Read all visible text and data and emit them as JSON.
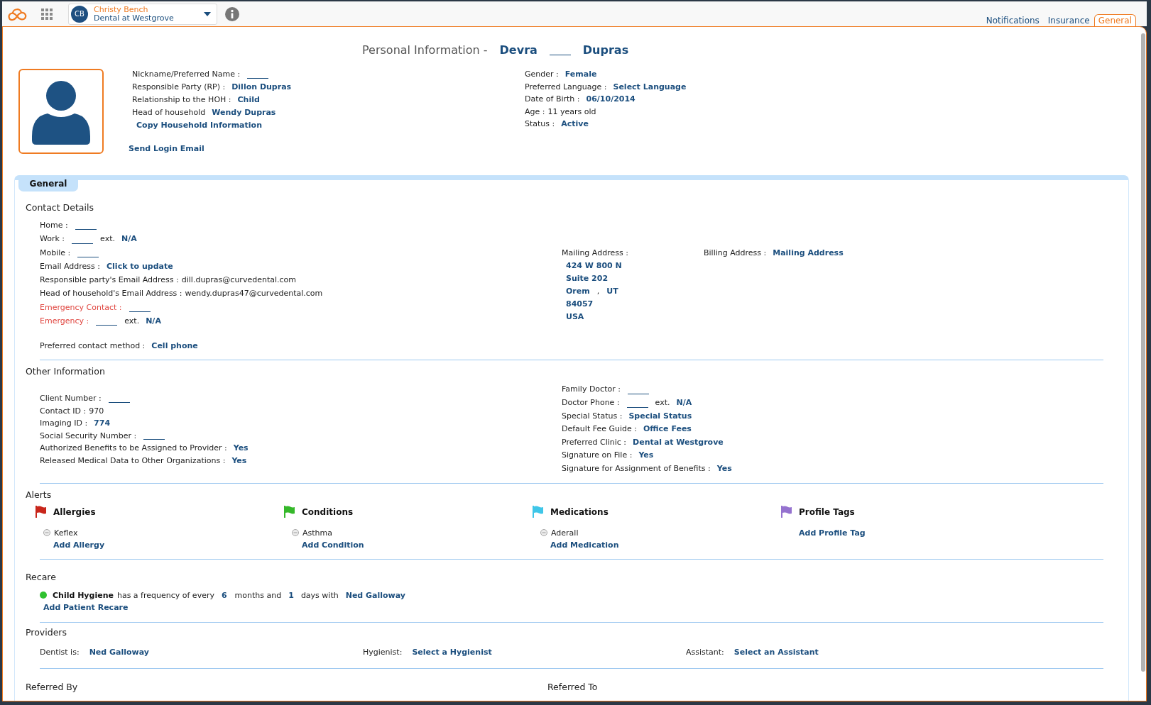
{
  "top_bar": {
    "user": {
      "initials": "CB",
      "name": "Christy Bench",
      "clinic": "Dental at Westgrove"
    }
  },
  "tabs": [
    {
      "label": "Notifications",
      "selected": false
    },
    {
      "label": "Insurance",
      "selected": false
    },
    {
      "label": "General",
      "selected": true
    }
  ],
  "title": {
    "label": "Personal Information -",
    "parts": [
      {
        "kind": "link",
        "text": "Devra"
      },
      {
        "kind": "blank"
      },
      {
        "kind": "link",
        "text": "Dupras"
      }
    ]
  },
  "profile": {
    "left_rows": [
      {
        "label": "Nickname/Preferred Name :",
        "values": [
          {
            "kind": "blank"
          }
        ]
      },
      {
        "label": "Responsible Party (RP) :",
        "values": [
          {
            "kind": "link",
            "text": "Dillon Dupras"
          }
        ]
      },
      {
        "label": "Relationship to the HOH :",
        "values": [
          {
            "kind": "link",
            "text": "Child"
          }
        ]
      },
      {
        "label": "Head of household",
        "values": [
          {
            "kind": "link",
            "text": "Wendy Dupras"
          }
        ]
      }
    ],
    "copy_link": "Copy Household Information",
    "login_link": "Send Login Email",
    "right_rows": [
      {
        "label": "Gender :",
        "values": [
          {
            "kind": "link",
            "text": "Female"
          }
        ]
      },
      {
        "label": "Preferred Language :",
        "values": [
          {
            "kind": "link",
            "text": "Select Language"
          }
        ]
      },
      {
        "label": "Date of Birth :",
        "values": [
          {
            "kind": "link",
            "text": "06/10/2014"
          }
        ]
      },
      {
        "label": "Age :",
        "values": [
          {
            "kind": "text",
            "text": "11 years old"
          }
        ]
      },
      {
        "label": "Status :",
        "values": [
          {
            "kind": "link",
            "text": "Active"
          }
        ]
      }
    ]
  },
  "section_tab": "General",
  "contact_details": {
    "heading": "Contact Details",
    "rows": [
      {
        "label": "Home :",
        "alert": false,
        "values": [
          {
            "kind": "blank"
          }
        ]
      },
      {
        "label": "Work :",
        "alert": false,
        "values": [
          {
            "kind": "blank"
          },
          {
            "kind": "label",
            "text": "ext."
          },
          {
            "kind": "link",
            "text": "N/A"
          }
        ]
      },
      {
        "label": "Mobile :",
        "alert": false,
        "values": [
          {
            "kind": "blank"
          }
        ]
      },
      {
        "label": "Email Address :",
        "alert": false,
        "values": [
          {
            "kind": "link",
            "text": "Click to update"
          }
        ]
      },
      {
        "label": "Responsible party's Email Address :",
        "alert": false,
        "values": [
          {
            "kind": "text",
            "text": "dill.dupras@curvedental.com"
          }
        ]
      },
      {
        "label": "Head of household's Email Address :",
        "alert": false,
        "values": [
          {
            "kind": "text",
            "text": "wendy.dupras47@curvedental.com"
          }
        ]
      },
      {
        "label": "Emergency Contact :",
        "alert": true,
        "values": [
          {
            "kind": "blank"
          }
        ]
      },
      {
        "label": "Emergency :",
        "alert": true,
        "values": [
          {
            "kind": "blank"
          },
          {
            "kind": "label",
            "text": "ext."
          },
          {
            "kind": "link",
            "text": "N/A"
          }
        ]
      }
    ],
    "preferred_contact": {
      "label": "Preferred contact method :",
      "values": [
        {
          "kind": "link",
          "text": "Cell phone"
        }
      ]
    },
    "mailing_address": {
      "label": "Mailing Address :",
      "street": "424 W 800 N",
      "unit": "Suite 202",
      "city": "Orem",
      "separator": ",",
      "state": "UT",
      "zip": "84057",
      "country": "USA"
    },
    "billing_address": {
      "label": "Billing Address :",
      "values": [
        {
          "kind": "link",
          "text": "Mailing Address"
        }
      ]
    }
  },
  "other_information": {
    "heading": "Other Information",
    "left_rows": [
      {
        "label": "Client Number :",
        "values": [
          {
            "kind": "blank"
          }
        ]
      },
      {
        "label": "Contact ID :",
        "values": [
          {
            "kind": "text",
            "text": "970"
          }
        ]
      },
      {
        "label": "Imaging ID :",
        "values": [
          {
            "kind": "link",
            "text": "774"
          }
        ]
      },
      {
        "label": "Social Security Number :",
        "values": [
          {
            "kind": "blank"
          }
        ]
      },
      {
        "label": "Authorized Benefits to be Assigned to Provider :",
        "values": [
          {
            "kind": "link",
            "text": "Yes"
          }
        ]
      },
      {
        "label": "Released Medical Data to Other Organizations :",
        "values": [
          {
            "kind": "link",
            "text": "Yes"
          }
        ]
      }
    ],
    "right_rows": [
      {
        "label": "Family Doctor :",
        "values": [
          {
            "kind": "blank"
          }
        ]
      },
      {
        "label": "Doctor Phone :",
        "values": [
          {
            "kind": "blank"
          },
          {
            "kind": "label",
            "text": "ext."
          },
          {
            "kind": "link",
            "text": "N/A"
          }
        ]
      },
      {
        "label": "Special Status :",
        "values": [
          {
            "kind": "link",
            "text": "Special Status"
          }
        ]
      },
      {
        "label": "Default Fee Guide :",
        "values": [
          {
            "kind": "link",
            "text": "Office Fees"
          }
        ]
      },
      {
        "label": "Preferred Clinic :",
        "values": [
          {
            "kind": "link",
            "text": "Dental at Westgrove"
          }
        ]
      },
      {
        "label": "Signature on File :",
        "values": [
          {
            "kind": "link",
            "text": "Yes"
          }
        ]
      },
      {
        "label": "Signature for Assignment of Benefits :",
        "values": [
          {
            "kind": "link",
            "text": "Yes"
          }
        ]
      }
    ]
  },
  "alerts": {
    "heading": "Alerts",
    "categories": [
      {
        "title": "Allergies",
        "color": "#c8261b",
        "items": [
          "Keflex"
        ],
        "add_link": "Add Allergy"
      },
      {
        "title": "Conditions",
        "color": "#35b82a",
        "items": [
          "Asthma"
        ],
        "add_link": "Add Condition"
      },
      {
        "title": "Medications",
        "color": "#3fc6e8",
        "items": [
          "Aderall"
        ],
        "add_link": "Add Medication"
      },
      {
        "title": "Profile Tags",
        "color": "#9572cf",
        "add_link": "Add Profile Tag"
      }
    ]
  },
  "recare": {
    "heading": "Recare",
    "items": [
      {
        "color": "#2fc12f",
        "name": "Child Hygiene",
        "frequency_label": "has a frequency of every",
        "months": "6",
        "months_label": "months and",
        "days": "1",
        "days_label": "days with",
        "provider": "Ned Galloway"
      }
    ],
    "add_link": "Add Patient Recare"
  },
  "providers": {
    "heading": "Providers",
    "items": [
      {
        "label": "Dentist is:",
        "value": "Ned Galloway"
      },
      {
        "label": "Hygienist:",
        "value": "Select a Hygienist"
      },
      {
        "label": "Assistant:",
        "value": "Select an Assistant"
      }
    ]
  },
  "referrals": {
    "headings": [
      "Referred By",
      "Referred To"
    ]
  }
}
